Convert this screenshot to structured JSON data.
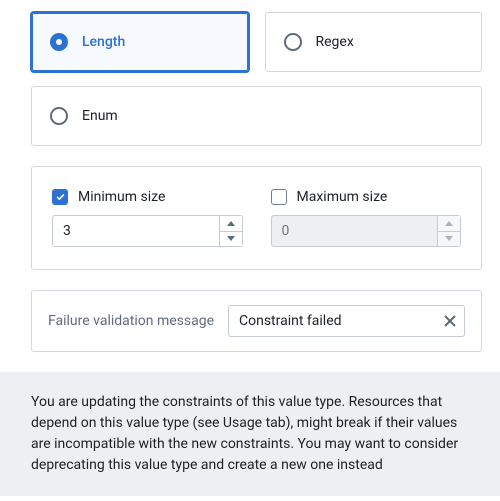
{
  "constraint_type": {
    "options": [
      {
        "id": "length",
        "label": "Length",
        "selected": true
      },
      {
        "id": "regex",
        "label": "Regex",
        "selected": false
      },
      {
        "id": "enum",
        "label": "Enum",
        "selected": false
      }
    ]
  },
  "length": {
    "min": {
      "label": "Minimum size",
      "enabled": true,
      "value": "3"
    },
    "max": {
      "label": "Maximum size",
      "enabled": false,
      "placeholder": "0"
    }
  },
  "failure_message": {
    "label": "Failure validation message",
    "value": "Constraint failed"
  },
  "warning": "You are updating the constraints of this value type. Resources that depend on this value type (see Usage tab), might break if their values are incompatible with the new constraints. You may want to consider deprecating this value type and create a new one instead"
}
